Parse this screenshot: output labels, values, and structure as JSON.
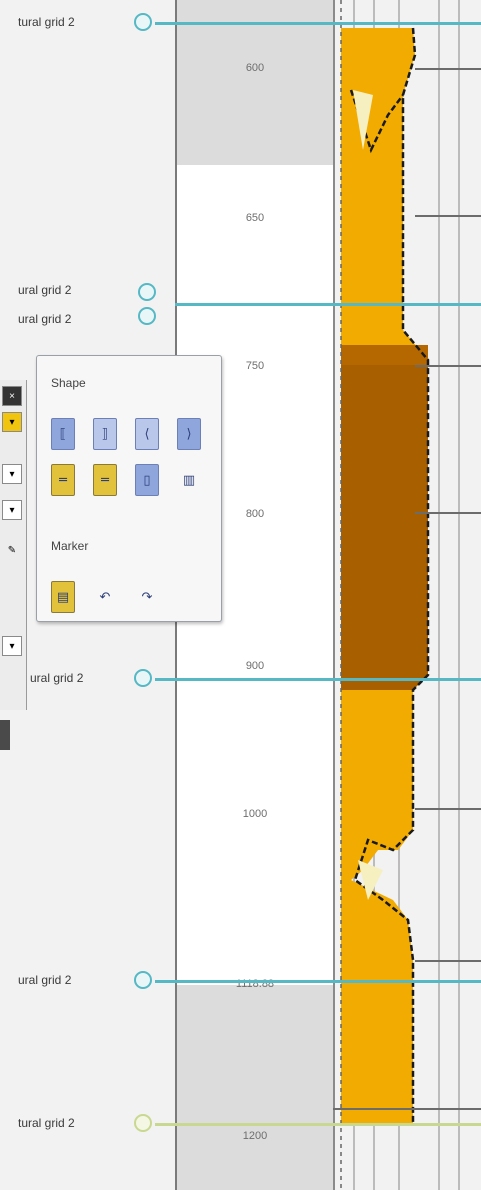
{
  "grid_labels": [
    {
      "text": "tural grid 2",
      "id": "grid-label-1"
    },
    {
      "text": "ural grid 2",
      "id": "grid-label-2"
    },
    {
      "text": "ural grid 2",
      "id": "grid-label-3"
    },
    {
      "text": "ural grid 2",
      "id": "grid-label-4"
    },
    {
      "text": "ural grid 2",
      "id": "grid-label-5"
    },
    {
      "text": "tural grid 2",
      "id": "grid-label-6"
    }
  ],
  "depth_labels": [
    "600",
    "650",
    "750",
    "800",
    "900",
    "1000",
    "1118.88",
    "1200"
  ],
  "popup": {
    "shape_label": "Shape",
    "marker_label": "Marker"
  },
  "colors": {
    "fill_yellow": "#f2ab00",
    "fill_brown": "#a85f00",
    "grid_line": "#55b8c4",
    "grid_line_last": "#c8d890"
  },
  "icons": [
    "grid-marker-icon",
    "shape-tool-icon",
    "marker-tool-icon"
  ]
}
